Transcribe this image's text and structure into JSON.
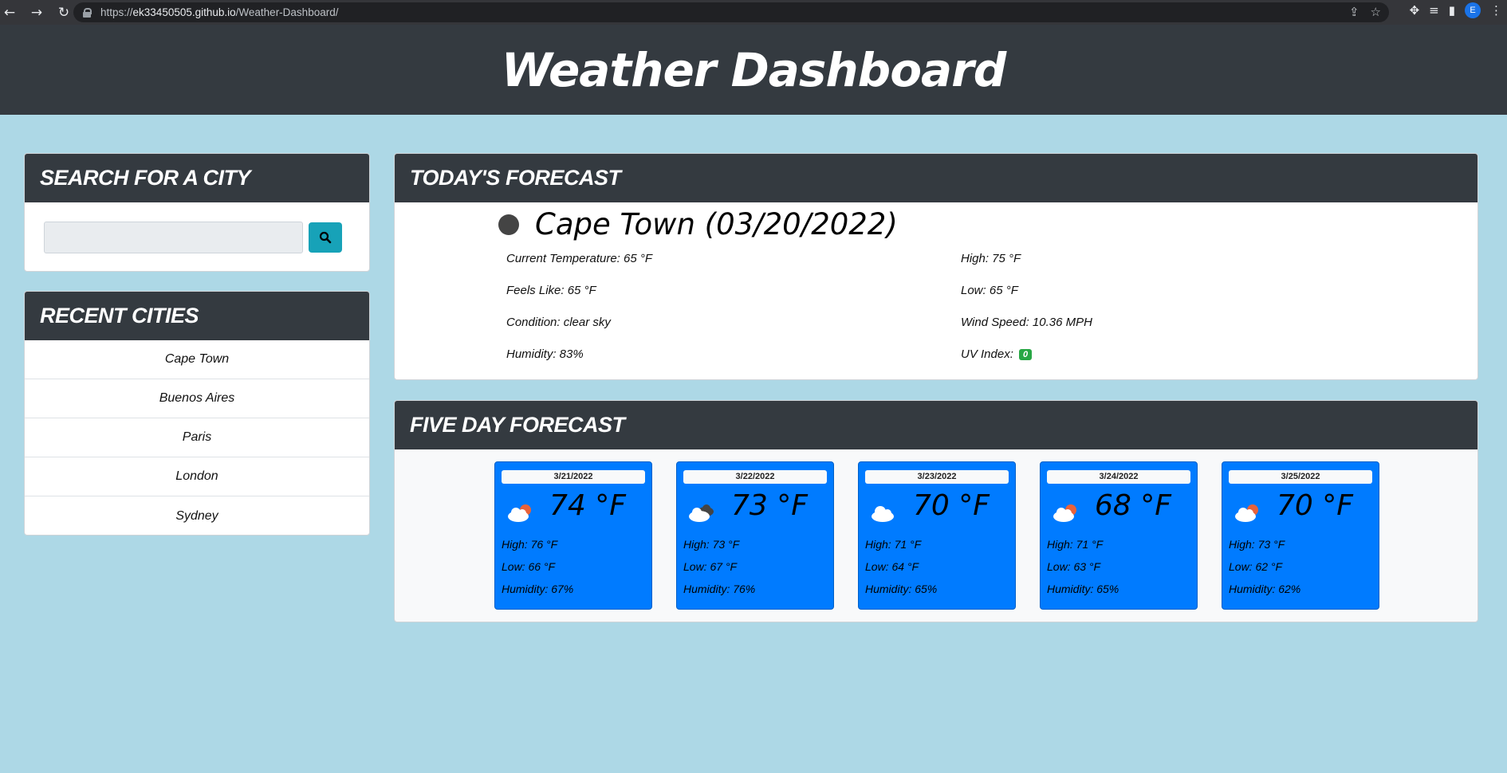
{
  "browser": {
    "url_prefix": "https://",
    "url_host": "ek33450505.github.io",
    "url_path": "/Weather-Dashboard/",
    "profile_initial": "E"
  },
  "header": {
    "title": "Weather Dashboard"
  },
  "search": {
    "title": "SEARCH FOR A CITY",
    "value": "",
    "placeholder": ""
  },
  "recent": {
    "title": "RECENT CITIES",
    "cities": [
      "Cape Town",
      "Buenos Aires",
      "Paris",
      "London",
      "Sydney"
    ]
  },
  "today": {
    "title": "TODAY'S FORECAST",
    "city_date": "Cape Town (03/20/2022)",
    "current_temp": "Current Temperature: 65 °F",
    "feels_like": "Feels Like: 65 °F",
    "condition": "Condition: clear sky",
    "humidity": "Humidity: 83%",
    "high": "High: 75 °F",
    "low": "Low: 65 °F",
    "wind": "Wind Speed: 10.36 MPH",
    "uv_label": "UV Index:",
    "uv_value": "0",
    "uv_color": "#28a745"
  },
  "five_day": {
    "title": "FIVE DAY FORECAST",
    "days": [
      {
        "date": "3/21/2022",
        "temp": "74 °F",
        "icon": "few-clouds-sun-icon",
        "high": "High: 76 °F",
        "low": "Low: 66 °F",
        "humidity": "Humidity: 67%"
      },
      {
        "date": "3/22/2022",
        "temp": "73 °F",
        "icon": "broken-clouds-icon",
        "high": "High: 73 °F",
        "low": "Low: 67 °F",
        "humidity": "Humidity: 76%"
      },
      {
        "date": "3/23/2022",
        "temp": "70 °F",
        "icon": "cloud-icon",
        "high": "High: 71 °F",
        "low": "Low: 64 °F",
        "humidity": "Humidity: 65%"
      },
      {
        "date": "3/24/2022",
        "temp": "68 °F",
        "icon": "few-clouds-sun-icon",
        "high": "High: 71 °F",
        "low": "Low: 63 °F",
        "humidity": "Humidity: 65%"
      },
      {
        "date": "3/25/2022",
        "temp": "70 °F",
        "icon": "few-clouds-sun-icon",
        "high": "High: 73 °F",
        "low": "Low: 62 °F",
        "humidity": "Humidity: 62%"
      }
    ]
  }
}
